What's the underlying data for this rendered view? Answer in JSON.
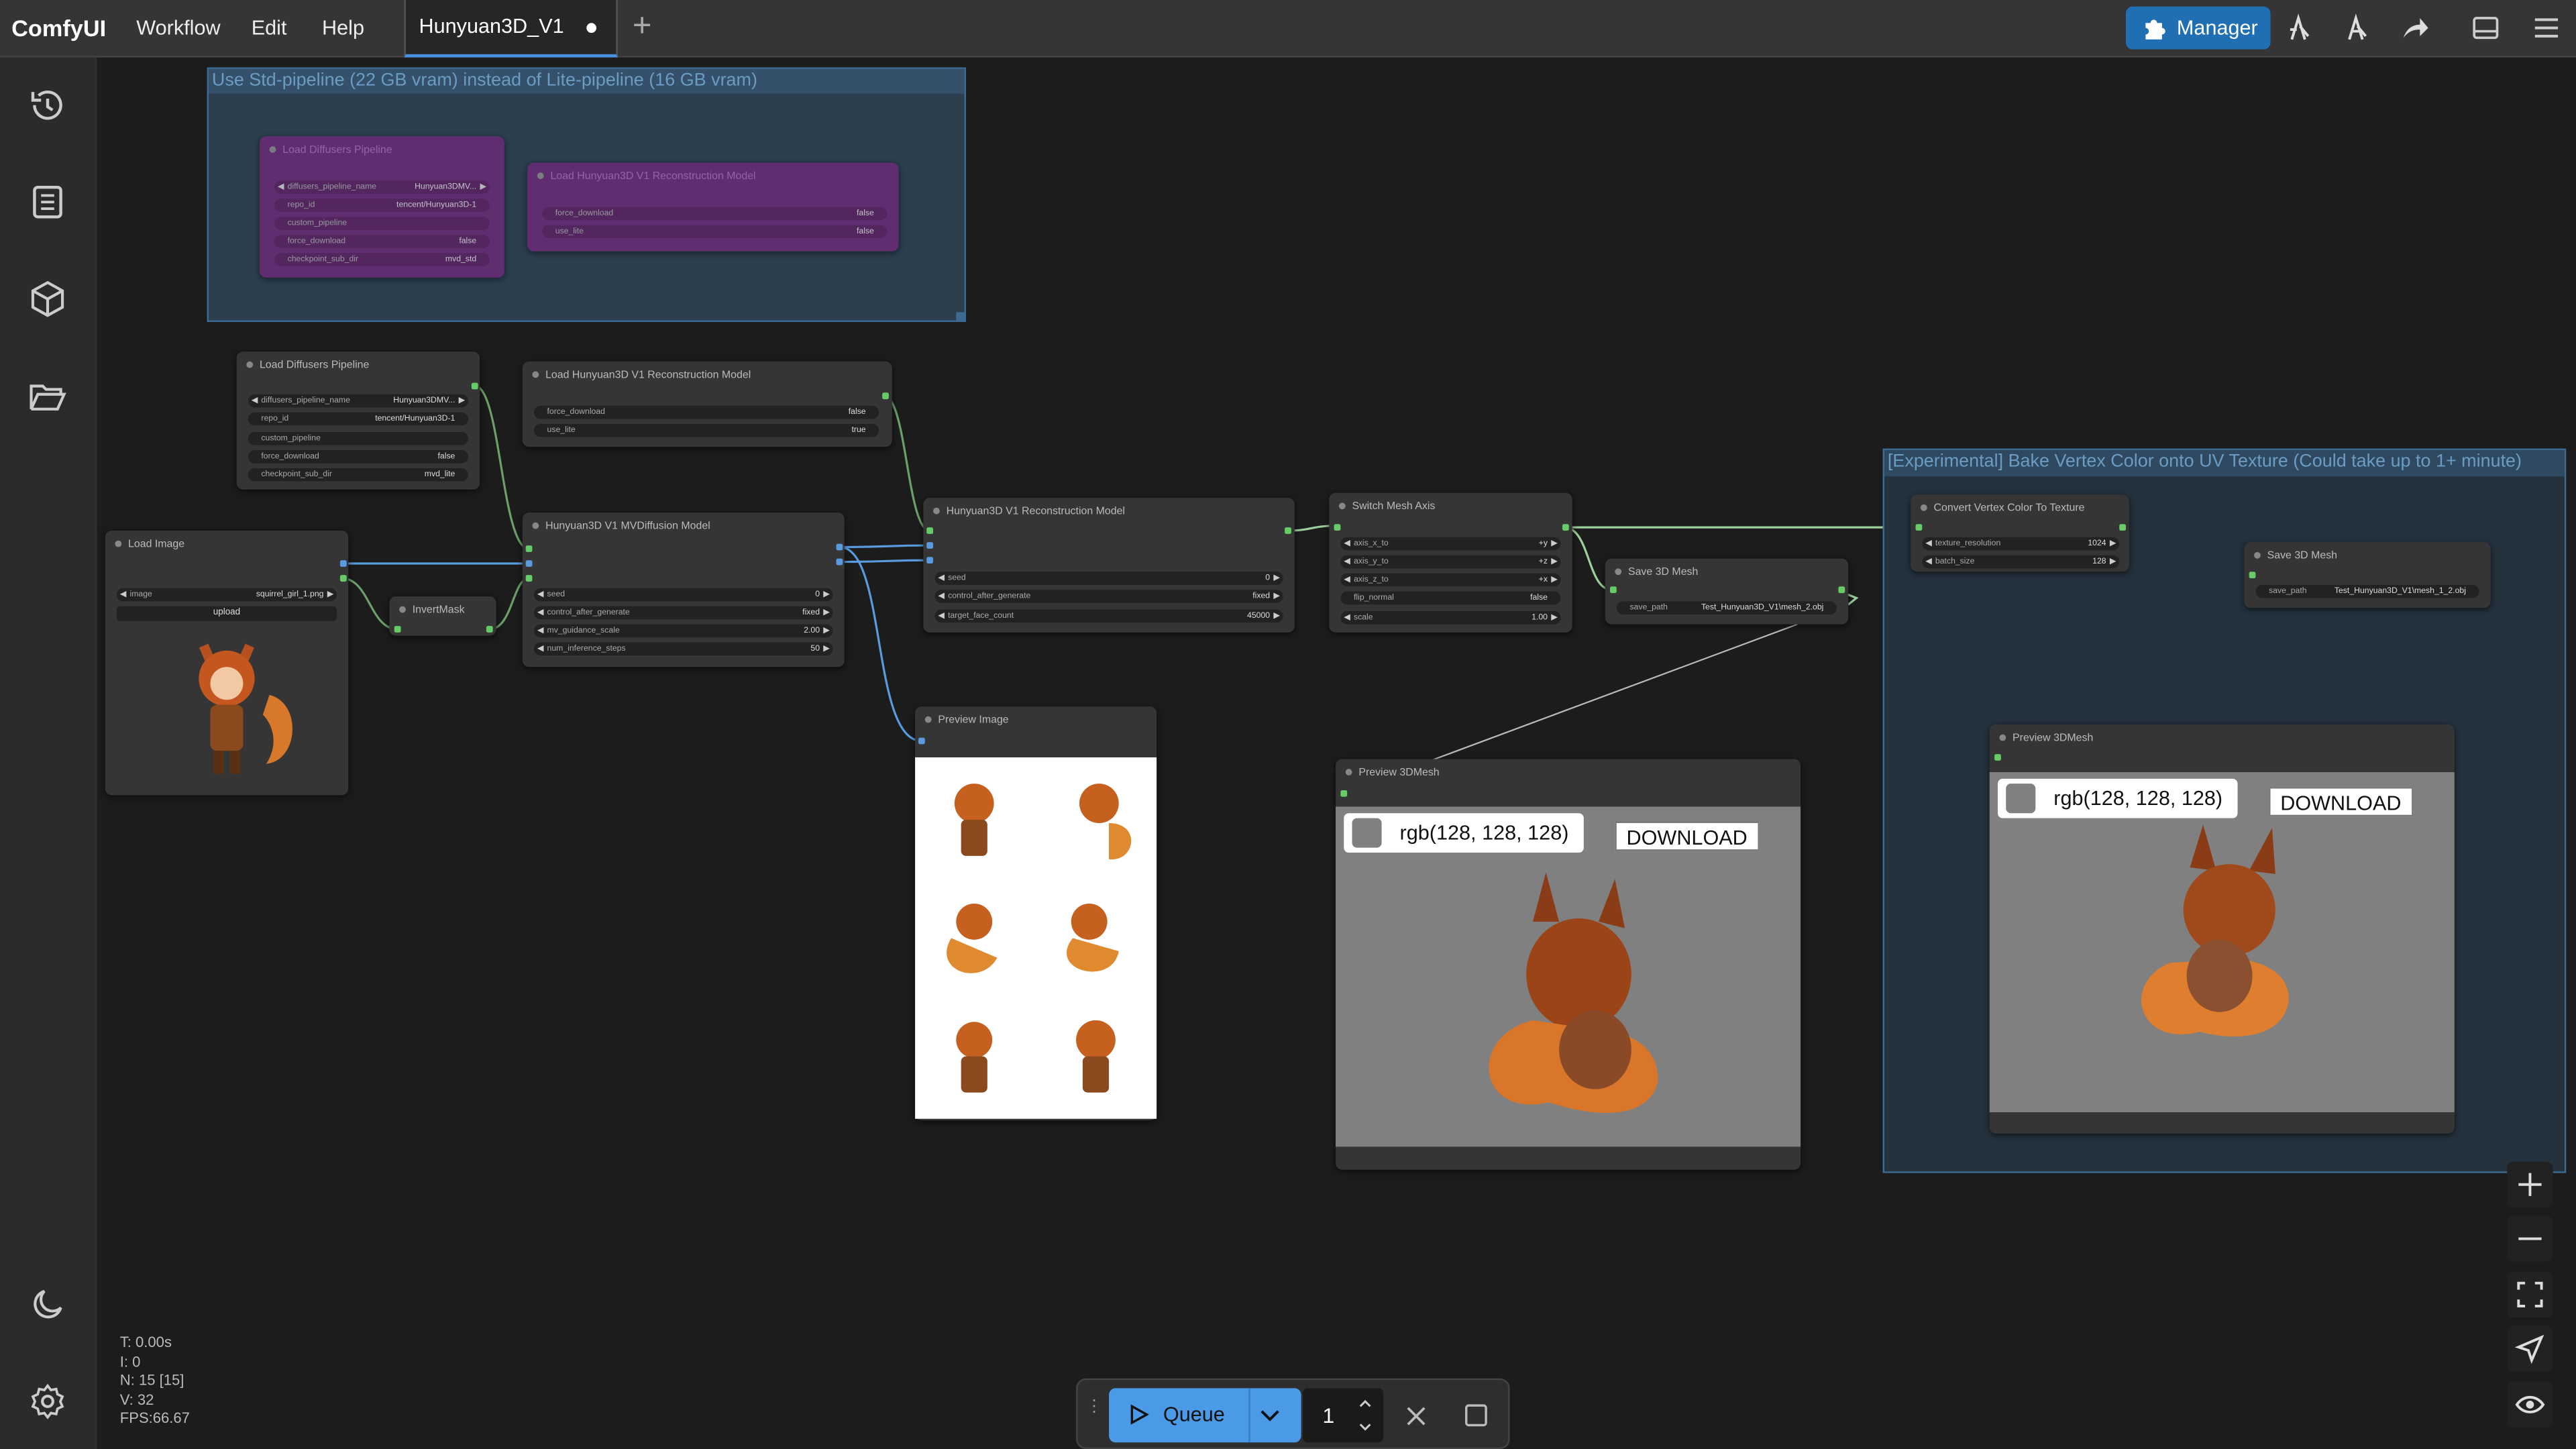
{
  "app": {
    "name": "ComfyUI"
  },
  "menu": [
    "Workflow",
    "Edit",
    "Help"
  ],
  "tab": {
    "label": "Hunyuan3D_V1"
  },
  "topbar": {
    "manager_label": "Manager"
  },
  "groups": {
    "std_pipeline": "Use Std-pipeline  (22 GB vram) instead of Lite-pipeline (16 GB vram)",
    "bake": "[Experimental] Bake Vertex Color onto UV Texture (Could take up to 1+ minute)"
  },
  "muted_nodes": {
    "load_diffusers": {
      "title": "Load Diffusers Pipeline",
      "w1": "diffusers_pipeline_name",
      "w1v": "Hunyuan3DMV...",
      "w2": "repo_id",
      "w2v": "tencent/Hunyuan3D-1",
      "w3": "custom_pipeline",
      "w4": "force_download",
      "w4v": "false",
      "w5": "checkpoint_sub_dir",
      "w5v": "mvd_std"
    },
    "load_recon": {
      "title": "Load Hunyuan3D V1 Reconstruction Model",
      "w1": "force_download",
      "w1v": "false",
      "w2": "use_lite",
      "w2v": "false"
    }
  },
  "nodes": {
    "load_diffusers": {
      "title": "Load Diffusers Pipeline",
      "w1": "diffusers_pipeline_name",
      "w1v": "Hunyuan3DMV...",
      "w2": "repo_id",
      "w2v": "tencent/Hunyuan3D-1",
      "w3": "custom_pipeline",
      "w4": "force_download",
      "w4v": "false",
      "w5": "checkpoint_sub_dir",
      "w5v": "mvd_lite"
    },
    "load_recon": {
      "title": "Load Hunyuan3D V1 Reconstruction Model",
      "w1": "force_download",
      "w1v": "false",
      "w2": "use_lite",
      "w2v": "true"
    },
    "load_image": {
      "title": "Load Image",
      "w1": "image",
      "w1v": "squirrel_girl_1.png",
      "upload": "upload"
    },
    "invert_mask": {
      "title": "InvertMask"
    },
    "mvdiffusion": {
      "title": "Hunyuan3D V1 MVDiffusion Model",
      "w1": "seed",
      "w1v": "0",
      "w2": "control_after_generate",
      "w2v": "fixed",
      "w3": "mv_guidance_scale",
      "w3v": "2.00",
      "w4": "num_inference_steps",
      "w4v": "50"
    },
    "recon": {
      "title": "Hunyuan3D V1 Reconstruction Model",
      "w1": "seed",
      "w1v": "0",
      "w2": "control_after_generate",
      "w2v": "fixed",
      "w3": "target_face_count",
      "w3v": "45000"
    },
    "preview_image": {
      "title": "Preview Image"
    },
    "switch_axis": {
      "title": "Switch Mesh Axis",
      "w1": "axis_x_to",
      "w1v": "+y",
      "w2": "axis_y_to",
      "w2v": "+z",
      "w3": "axis_z_to",
      "w3v": "+x",
      "w4": "flip_normal",
      "w4v": "false",
      "w5": "scale",
      "w5v": "1.00"
    },
    "save_mesh": {
      "title": "Save 3D Mesh",
      "w1": "save_path",
      "w1v": "Test_Hunyuan3D_V1\\mesh_2.obj"
    },
    "preview_mesh": {
      "title": "Preview 3DMesh",
      "color": "rgb(128, 128, 128)",
      "download": "DOWNLOAD"
    },
    "convert_vc": {
      "title": "Convert Vertex Color To Texture",
      "w1": "texture_resolution",
      "w1v": "1024",
      "w2": "batch_size",
      "w2v": "128"
    },
    "save_mesh2": {
      "title": "Save 3D Mesh",
      "w1": "save_path",
      "w1v": "Test_Hunyuan3D_V1\\mesh_1_2.obj"
    },
    "preview_mesh2": {
      "title": "Preview 3DMesh",
      "color": "rgb(128, 128, 128)",
      "download": "DOWNLOAD"
    }
  },
  "queue": {
    "label": "Queue",
    "count": "1"
  },
  "stats": {
    "t": "T: 0.00s",
    "i": "I: 0",
    "n": "N: 15 [15]",
    "v": "V: 32",
    "fps": "FPS:66.67"
  },
  "colors": {
    "accent": "#1f6fb2",
    "queue": "#4a9ae8",
    "group_border": "#3b6b93",
    "muted_node": "#7a2e8a"
  }
}
